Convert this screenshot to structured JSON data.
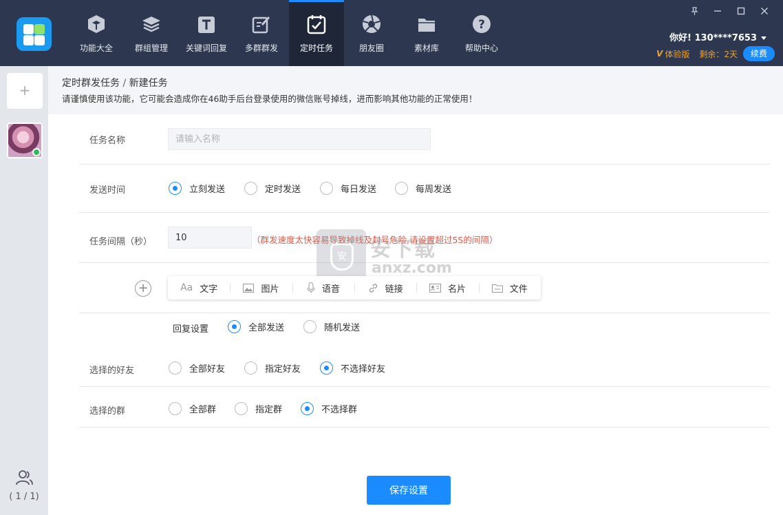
{
  "app": {
    "user_greeting": "你好! 130****7653",
    "edition": "体验版",
    "remaining": "剩余：2天",
    "renew_label": "续费"
  },
  "nav": [
    {
      "label": "功能大全",
      "icon": "cube-icon"
    },
    {
      "label": "群组管理",
      "icon": "layers-icon"
    },
    {
      "label": "关键词回复",
      "icon": "text-t-icon"
    },
    {
      "label": "多群群发",
      "icon": "edit-icon"
    },
    {
      "label": "定时任务",
      "icon": "calendar-check-icon",
      "active": true
    },
    {
      "label": "朋友圈",
      "icon": "aperture-icon"
    },
    {
      "label": "素材库",
      "icon": "folder-icon"
    },
    {
      "label": "帮助中心",
      "icon": "help-icon"
    }
  ],
  "sidebar": {
    "add_label": "+",
    "account_count": "( 1 / 1)"
  },
  "header": {
    "breadcrumb_parent": "定时群发任务",
    "breadcrumb_sep": " / ",
    "breadcrumb_current": "新建任务",
    "warning": "请谨慎使用该功能，它可能会造成你在46助手后台登录使用的微信账号掉线，进而影响其他功能的正常使用！"
  },
  "form": {
    "task_name_label": "任务名称",
    "task_name_placeholder": "请输入名称",
    "send_time_label": "发送时间",
    "send_time_options": [
      "立刻发送",
      "定时发送",
      "每日发送",
      "每周发送"
    ],
    "interval_label": "任务间隔（秒）",
    "interval_value": "10",
    "interval_hint": "（群发速度太快容易导致掉线及封号危险,请设置超过5S的间隔）",
    "content_tools": [
      {
        "label": "文字",
        "icon": "text-aa-icon"
      },
      {
        "label": "图片",
        "icon": "image-icon"
      },
      {
        "label": "语音",
        "icon": "mic-icon"
      },
      {
        "label": "链接",
        "icon": "link-icon"
      },
      {
        "label": "名片",
        "icon": "card-icon"
      },
      {
        "label": "文件",
        "icon": "file-icon"
      }
    ],
    "reply_label": "回复设置",
    "reply_options": [
      "全部发送",
      "随机发送"
    ],
    "friends_label": "选择的好友",
    "friends_options": [
      "全部好友",
      "指定好友",
      "不选择好友"
    ],
    "groups_label": "选择的群",
    "groups_options": [
      "全部群",
      "指定群",
      "不选择群"
    ],
    "save_label": "保存设置"
  },
  "watermark": {
    "zh": "安下载",
    "en": "anxz.com",
    "badge": "安"
  },
  "colors": {
    "topbar": "#2d3850",
    "accent": "#1a8cff",
    "warning_text": "#e25a4a",
    "trial": "#f0a22a"
  }
}
